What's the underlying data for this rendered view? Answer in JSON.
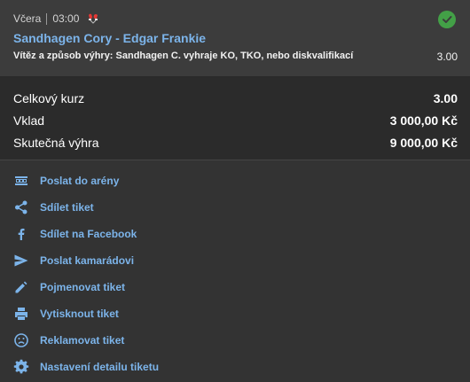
{
  "bet": {
    "day": "Včera",
    "time": "03:00",
    "sport_icon": "boxing-gloves-icon",
    "status_icon": "check-circle-icon",
    "match": "Sandhagen Cory - Edgar Frankie",
    "market": "Vítěz a způsob výhry: Sandhagen C. vyhraje KO, TKO, nebo diskvalifikací",
    "odds": "3.00"
  },
  "summary": {
    "total_odds_label": "Celkový kurz",
    "total_odds_value": "3.00",
    "stake_label": "Vklad",
    "stake_value": "3 000,00 Kč",
    "payout_label": "Skutečná výhra",
    "payout_value": "9 000,00 Kč"
  },
  "actions": [
    {
      "label": "Poslat do arény",
      "icon": "arena-icon"
    },
    {
      "label": "Sdílet tiket",
      "icon": "share-icon"
    },
    {
      "label": "Sdílet na Facebook",
      "icon": "facebook-icon"
    },
    {
      "label": "Poslat kamarádovi",
      "icon": "send-icon"
    },
    {
      "label": "Pojmenovat tiket",
      "icon": "pencil-icon"
    },
    {
      "label": "Vytisknout tiket",
      "icon": "printer-icon"
    },
    {
      "label": "Reklamovat tiket",
      "icon": "sad-face-icon"
    },
    {
      "label": "Nastavení detailu tiketu",
      "icon": "gear-icon"
    }
  ],
  "colors": {
    "link": "#7cb4ea",
    "success": "#43a047",
    "card": "#3c3c3c",
    "summary": "#2b2b2b",
    "background": "#333333"
  }
}
